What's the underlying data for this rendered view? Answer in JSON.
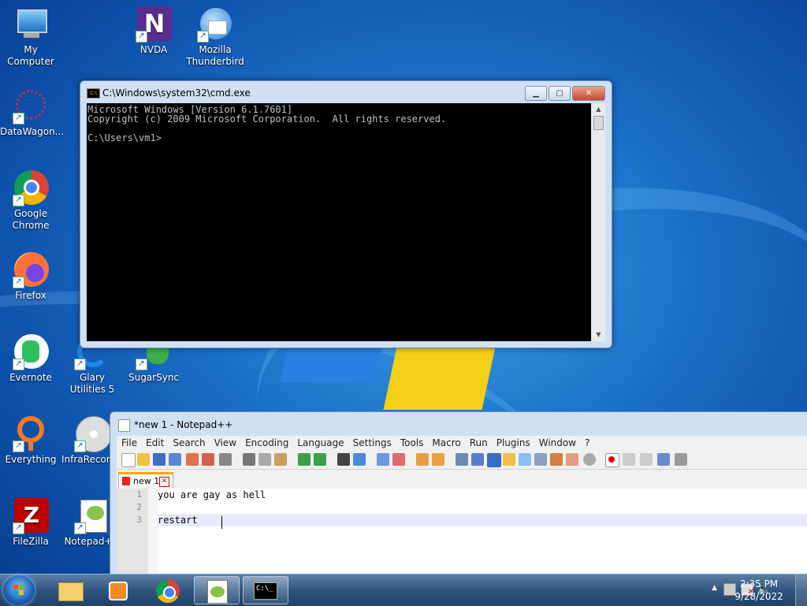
{
  "desktop": {
    "icons": [
      {
        "label": "My Computer"
      },
      {
        "label": "NVDA"
      },
      {
        "label": "Mozilla Thunderbird"
      },
      {
        "label": "DataWagon..."
      },
      {
        "label": "Google Chrome"
      },
      {
        "label": "Firefox"
      },
      {
        "label": "Evernote"
      },
      {
        "label": "Glary Utilities 5"
      },
      {
        "label": "SugarSync"
      },
      {
        "label": "Everything"
      },
      {
        "label": "InfraRecorder"
      },
      {
        "label": "FileZilla"
      },
      {
        "label": "Notepad++"
      }
    ]
  },
  "cmd": {
    "title": "C:\\Windows\\system32\\cmd.exe",
    "output": "Microsoft Windows [Version 6.1.7601]\nCopyright (c) 2009 Microsoft Corporation.  All rights reserved.\n\nC:\\Users\\vm1>"
  },
  "notepad": {
    "title": "*new 1 - Notepad++",
    "menu": [
      "File",
      "Edit",
      "Search",
      "View",
      "Encoding",
      "Language",
      "Settings",
      "Tools",
      "Macro",
      "Run",
      "Plugins",
      "Window",
      "?"
    ],
    "tab_label": "new 1",
    "line_numbers": [
      "1",
      "2",
      "3"
    ],
    "lines": [
      "you are gay as hell",
      "",
      "restart "
    ]
  },
  "taskbar": {
    "time": "2:35 PM",
    "date": "9/28/2022",
    "cmd_label": "C:\\_"
  }
}
